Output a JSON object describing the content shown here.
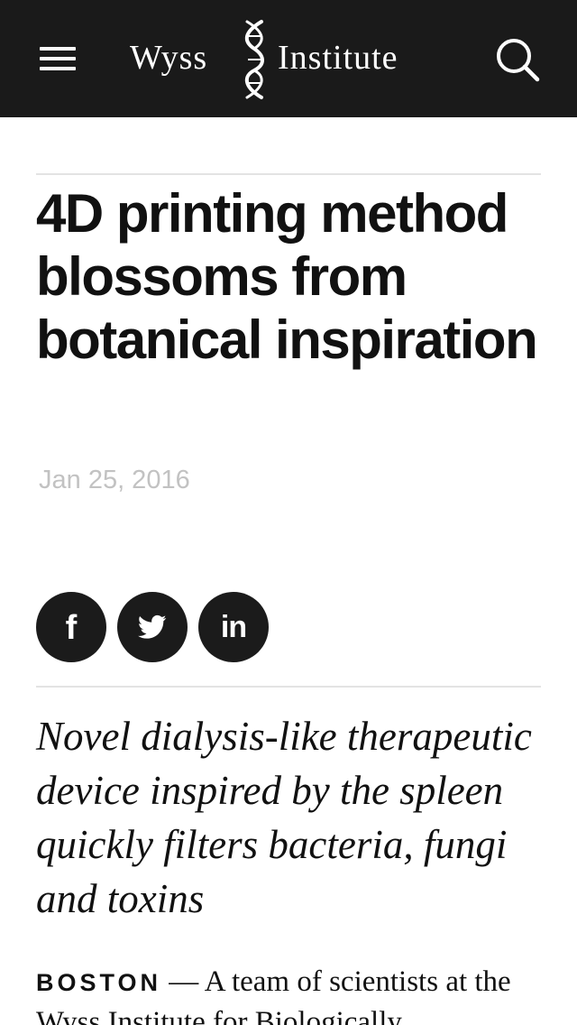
{
  "header": {
    "menu_icon": "hamburger-menu-icon",
    "logo": {
      "left_word": "Wyss",
      "right_word": "Institute",
      "emblem_icon": "dna-helix-icon"
    },
    "search_icon": "search-icon",
    "background_color": "#1a1a1a"
  },
  "article": {
    "title": "4D printing method blossoms from botanical inspiration",
    "date": "Jan 25, 2016",
    "share": {
      "facebook_glyph": "f",
      "linkedin_glyph": "in",
      "twitter_icon": "twitter-bird-icon",
      "button_color": "#1b1b1b"
    },
    "subtitle": "Novel dialysis-like therapeutic device inspired by the spleen quickly filters bacteria, fungi and toxins",
    "dateline": "BOSTON",
    "lead": " — A team of scientists at the Wyss Institute for Biologically"
  }
}
